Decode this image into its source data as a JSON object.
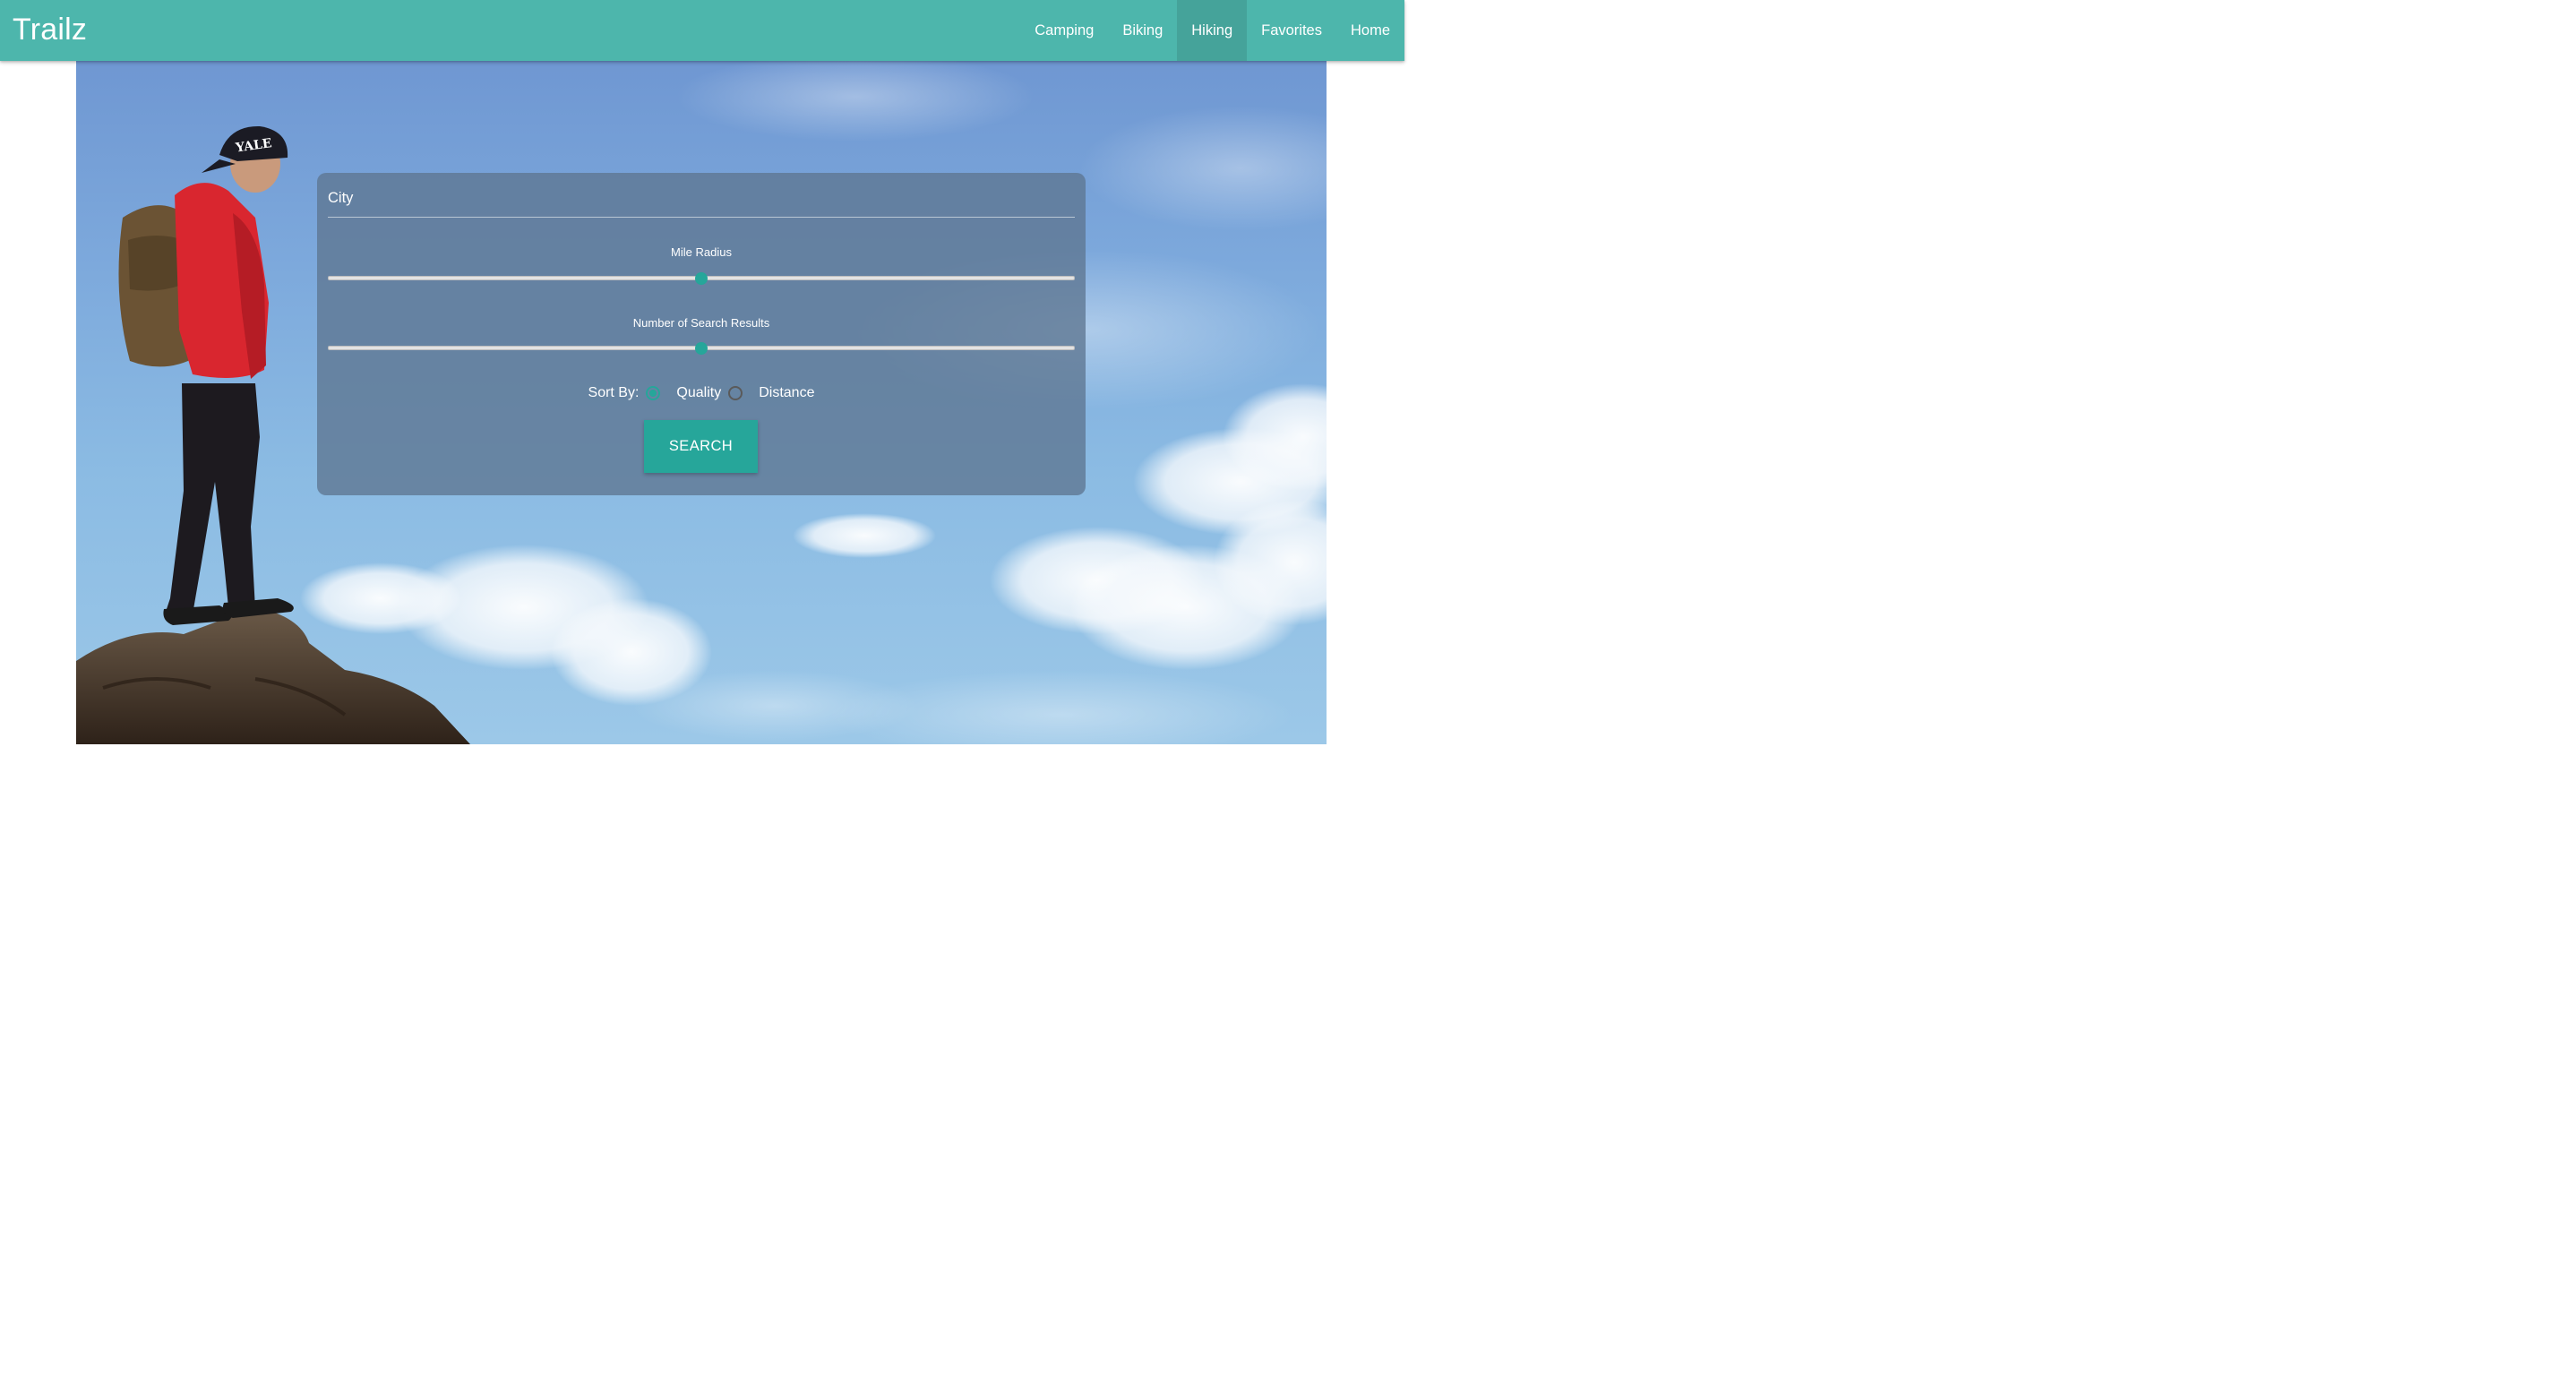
{
  "app": {
    "brand": "Trailz"
  },
  "nav": {
    "items": [
      {
        "label": "Camping",
        "active": false
      },
      {
        "label": "Biking",
        "active": false
      },
      {
        "label": "Hiking",
        "active": true
      },
      {
        "label": "Favorites",
        "active": false
      },
      {
        "label": "Home",
        "active": false
      }
    ]
  },
  "search": {
    "city_placeholder": "City",
    "city_value": "",
    "mile_radius_label": "Mile Radius",
    "mile_radius_fraction": 0.5,
    "results_label": "Number of Search Results",
    "results_fraction": 0.5,
    "sort_label": "Sort By:",
    "sort_options": [
      {
        "label": "Quality",
        "selected": true
      },
      {
        "label": "Distance",
        "selected": false
      }
    ],
    "button_label": "SEARCH"
  },
  "colors": {
    "navbar": "#4db6ac",
    "accent": "#26a69a"
  }
}
